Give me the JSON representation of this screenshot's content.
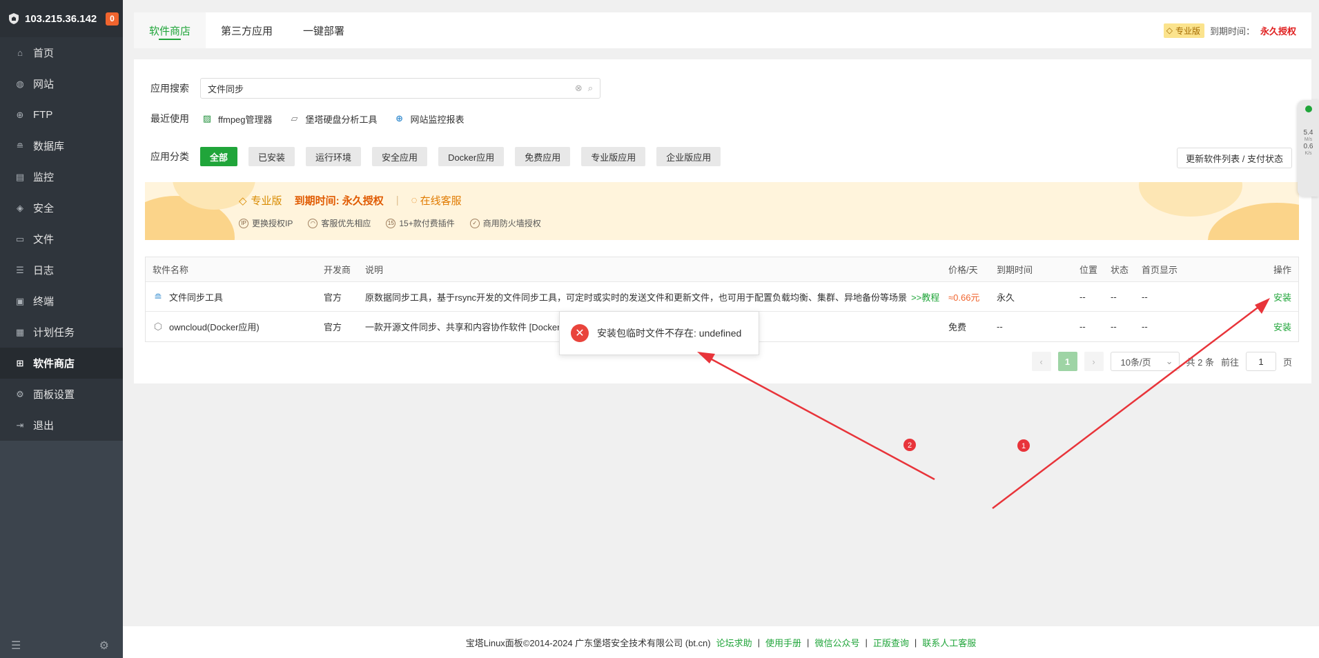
{
  "sidebar": {
    "server_ip": "103.215.36.142",
    "alert_count": "0",
    "items": [
      {
        "label": "首页",
        "icon": "home-icon"
      },
      {
        "label": "网站",
        "icon": "globe-icon"
      },
      {
        "label": "FTP",
        "icon": "ftp-icon"
      },
      {
        "label": "数据库",
        "icon": "database-icon"
      },
      {
        "label": "监控",
        "icon": "monitor-icon"
      },
      {
        "label": "安全",
        "icon": "shield-icon"
      },
      {
        "label": "文件",
        "icon": "folder-icon"
      },
      {
        "label": "日志",
        "icon": "log-icon"
      },
      {
        "label": "终端",
        "icon": "terminal-icon"
      },
      {
        "label": "计划任务",
        "icon": "cron-icon"
      },
      {
        "label": "软件商店",
        "icon": "store-icon"
      },
      {
        "label": "面板设置",
        "icon": "settings-icon"
      },
      {
        "label": "退出",
        "icon": "logout-icon"
      }
    ],
    "active_index": 10
  },
  "tabs": [
    {
      "label": "软件商店",
      "active": true
    },
    {
      "label": "第三方应用",
      "active": false
    },
    {
      "label": "一键部署",
      "active": false
    }
  ],
  "top_right": {
    "pro_label": "专业版",
    "expire_label": "到期时间：",
    "expire_value": "永久授权"
  },
  "search": {
    "label": "应用搜索",
    "value": "文件同步"
  },
  "recent": {
    "label": "最近使用",
    "items": [
      {
        "label": "ffmpeg管理器",
        "icon": "ffmpeg-icon"
      },
      {
        "label": "堡塔硬盘分析工具",
        "icon": "disk-icon"
      },
      {
        "label": "网站监控报表",
        "icon": "web-monitor-icon"
      }
    ]
  },
  "categories": {
    "label": "应用分类",
    "items": [
      "全部",
      "已安装",
      "运行环境",
      "安全应用",
      "Docker应用",
      "免费应用",
      "专业版应用",
      "企业版应用"
    ],
    "active_index": 0,
    "update_button": "更新软件列表 / 支付状态"
  },
  "banner": {
    "pro": "专业版",
    "expire": "到期时间: 永久授权",
    "customer_service": "在线客服",
    "features": [
      "更换授权IP",
      "客服优先相应",
      "15+款付费插件",
      "商用防火墙授权"
    ]
  },
  "table": {
    "headers": {
      "name": "软件名称",
      "dev": "开发商",
      "desc": "说明",
      "price": "价格/天",
      "expire": "到期时间",
      "position": "位置",
      "status": "状态",
      "home": "首页显示",
      "op": "操作"
    },
    "rows": [
      {
        "name": "文件同步工具",
        "dev": "官方",
        "desc": "原数据同步工具，基于rsync开发的文件同步工具，可定时或实时的发送文件和更新文件，也可用于配置负载均衡、集群、异地备份等场景",
        "tutorial": ">>教程",
        "price": "≈0.66元",
        "expire": "永久",
        "position": "--",
        "status": "--",
        "home": "--",
        "op": "安装"
      },
      {
        "name": "owncloud(Docker应用)",
        "dev": "官方",
        "desc": "一款开源文件同步、共享和内容协作软件 [Docker应用]",
        "tutorial": "",
        "price": "免费",
        "expire": "--",
        "position": "--",
        "status": "--",
        "home": "--",
        "op": "安装"
      }
    ]
  },
  "pagination": {
    "current": "1",
    "page_size": "10条/页",
    "total": "共 2 条",
    "goto_label": "前往",
    "goto_value": "1",
    "page_unit": "页"
  },
  "toast": {
    "message": "安装包临时文件不存在: undefined"
  },
  "net_widget": {
    "up_value": "5.4",
    "up_unit": "M/s",
    "down_value": "0.6",
    "down_unit": "K/s"
  },
  "annotations": [
    "2",
    "1"
  ],
  "footer": {
    "copyright": "宝塔Linux面板©2014-2024 广东堡塔安全技术有限公司 (bt.cn)",
    "links": [
      "论坛求助",
      "使用手册",
      "微信公众号",
      "正版查询",
      "联系人工客服"
    ]
  },
  "colors": {
    "accent": "#20a53a",
    "error": "#e9443c",
    "arrow": "#e8343a",
    "sidebar_bg": "#3c444d"
  }
}
